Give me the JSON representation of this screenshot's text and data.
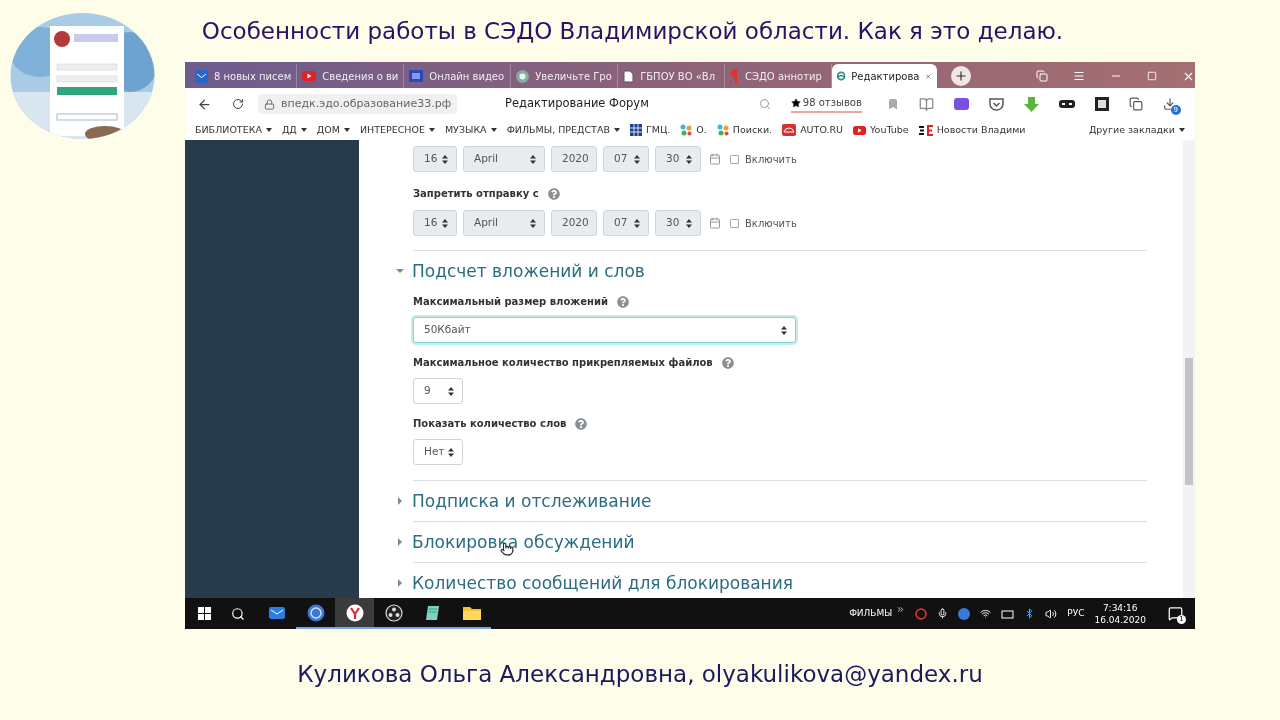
{
  "header": {
    "title": "Особенности работы в СЭДО Владимирской области. Как я это делаю."
  },
  "browser": {
    "tabs": [
      {
        "label": "8 новых писем",
        "kind": "mail",
        "selected": false
      },
      {
        "label": "Сведения о ви",
        "kind": "play",
        "selected": false
      },
      {
        "label": "Онлайн видео",
        "kind": "film",
        "selected": false
      },
      {
        "label": "Увеличьте Гро",
        "kind": "circle",
        "selected": false
      },
      {
        "label": "ГБПОУ ВО «Вл",
        "kind": "document",
        "selected": false
      },
      {
        "label": "СЭДО аннотир",
        "kind": "yandex",
        "selected": false
      },
      {
        "label": "Редактирова",
        "kind": "swirl",
        "selected": true
      }
    ],
    "url": "впедк.эдо.образование33.рф",
    "page_title": "Редактирование Форум",
    "reviews": "98 отзывов",
    "downloads_badge": "9",
    "bookmarks": [
      {
        "label": "БИБЛИОТЕКА",
        "kind": "folder"
      },
      {
        "label": "ДД",
        "kind": "folder"
      },
      {
        "label": "ДОМ",
        "kind": "folder"
      },
      {
        "label": "ИНТЕРЕСНОЕ",
        "kind": "folder"
      },
      {
        "label": "МУЗЫКА",
        "kind": "folder"
      },
      {
        "label": "ФИЛЬМЫ, ПРЕДСТАВ",
        "kind": "folder"
      },
      {
        "label": "ГМЦ.",
        "kind": "grid"
      },
      {
        "label": "О.",
        "kind": "dots"
      },
      {
        "label": "Поиски.",
        "kind": "dots"
      },
      {
        "label": "AUTO.RU",
        "kind": "car"
      },
      {
        "label": "YouTube",
        "kind": "play"
      },
      {
        "label": "Новости Владими",
        "kind": "bars"
      }
    ],
    "other_bookmarks": "Другие закладки"
  },
  "form": {
    "date_rows": [
      {
        "label": null,
        "fields": [
          "16",
          "April",
          "2020",
          "07",
          "30"
        ],
        "enable_label": "Включить",
        "checked": false
      },
      {
        "label": "Запретить отправку с",
        "fields": [
          "16",
          "April",
          "2020",
          "07",
          "30"
        ],
        "enable_label": "Включить",
        "checked": false
      }
    ],
    "sections": [
      {
        "title": "Подсчет вложений и слов",
        "expanded": true,
        "fields": [
          {
            "label": "Максимальный размер вложений",
            "value": "50Кбайт",
            "kind": "wide",
            "focused": true
          },
          {
            "label": "Максимальное количество прикрепляемых файлов",
            "value": "9",
            "kind": "narrow",
            "focused": false
          },
          {
            "label": "Показать количество слов",
            "value": "Нет",
            "kind": "narrow",
            "focused": false
          }
        ]
      },
      {
        "title": "Подписка и отслеживание",
        "expanded": false
      },
      {
        "title": "Блокировка обсуждений",
        "expanded": false
      },
      {
        "title": "Количество сообщений для блокирования",
        "expanded": false
      }
    ]
  },
  "taskbar": {
    "apps": [
      {
        "kind": "mail",
        "selected": false,
        "running": false
      },
      {
        "kind": "qb",
        "selected": false,
        "running": true
      },
      {
        "kind": "yandex",
        "selected": true,
        "running": true
      },
      {
        "kind": "obs",
        "selected": false,
        "running": true
      },
      {
        "kind": "notes",
        "selected": false,
        "running": true
      },
      {
        "kind": "folder",
        "selected": false,
        "running": true
      }
    ],
    "tray_label": "ФИЛЬМЫ",
    "language": "РУС",
    "time": "7:34:16",
    "date": "16.04.2020",
    "notifications": "1"
  },
  "footer": {
    "text": "Куликова Ольга Александровна, olyakulikova@yandex.ru"
  }
}
